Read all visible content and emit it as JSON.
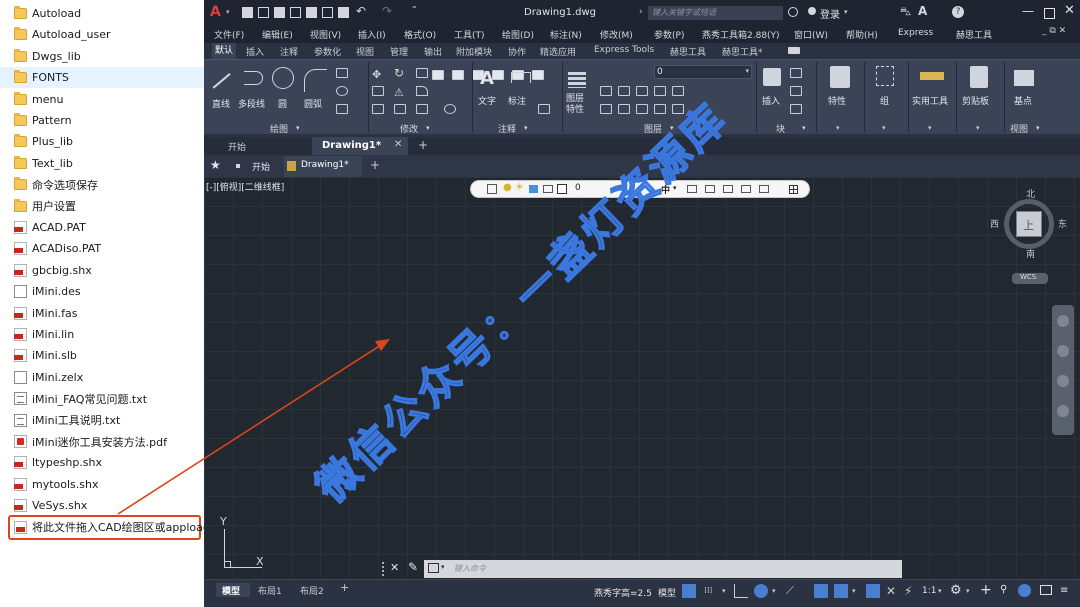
{
  "explorer": {
    "files": [
      {
        "name": "Autoload",
        "type": "folder",
        "selected": false,
        "highlight": false
      },
      {
        "name": "Autoload_user",
        "type": "folder",
        "selected": false,
        "highlight": false
      },
      {
        "name": "Dwgs_lib",
        "type": "folder",
        "selected": false,
        "highlight": false
      },
      {
        "name": "FONTS",
        "type": "folder",
        "selected": true,
        "highlight": false
      },
      {
        "name": "menu",
        "type": "folder",
        "selected": false,
        "highlight": false
      },
      {
        "name": "Pattern",
        "type": "folder",
        "selected": false,
        "highlight": false
      },
      {
        "name": "Plus_lib",
        "type": "folder",
        "selected": false,
        "highlight": false
      },
      {
        "name": "Text_lib",
        "type": "folder",
        "selected": false,
        "highlight": false
      },
      {
        "name": "命令选项保存",
        "type": "folder",
        "selected": false,
        "highlight": false
      },
      {
        "name": "用户设置",
        "type": "folder",
        "selected": false,
        "highlight": false
      },
      {
        "name": "ACAD.PAT",
        "type": "red",
        "selected": false,
        "highlight": false
      },
      {
        "name": "ACADiso.PAT",
        "type": "red",
        "selected": false,
        "highlight": false
      },
      {
        "name": "gbcbig.shx",
        "type": "red",
        "selected": false,
        "highlight": false
      },
      {
        "name": "iMini.des",
        "type": "doc",
        "selected": false,
        "highlight": false
      },
      {
        "name": "iMini.fas",
        "type": "red",
        "selected": false,
        "highlight": false
      },
      {
        "name": "iMini.lin",
        "type": "red",
        "selected": false,
        "highlight": false
      },
      {
        "name": "iMini.slb",
        "type": "red",
        "selected": false,
        "highlight": false
      },
      {
        "name": "iMini.zelx",
        "type": "doc",
        "selected": false,
        "highlight": false
      },
      {
        "name": "iMini_FAQ常见问题.txt",
        "type": "txt",
        "selected": false,
        "highlight": false
      },
      {
        "name": "iMini工具说明.txt",
        "type": "txt",
        "selected": false,
        "highlight": false
      },
      {
        "name": "iMini迷你工具安装方法.pdf",
        "type": "pdf",
        "selected": false,
        "highlight": false
      },
      {
        "name": "ltypeshp.shx",
        "type": "red",
        "selected": false,
        "highlight": false
      },
      {
        "name": "mytools.shx",
        "type": "red",
        "selected": false,
        "highlight": false
      },
      {
        "name": "VeSys.shx",
        "type": "red",
        "selected": false,
        "highlight": false
      },
      {
        "name": "将此文件拖入CAD绘图区或appload命...",
        "type": "lsp",
        "selected": false,
        "highlight": true
      }
    ]
  },
  "app": {
    "doc_title": "Drawing1.dwg",
    "search_placeholder": "键入关键字或短语",
    "login": "登录",
    "menu": [
      "文件(F)",
      "编辑(E)",
      "视图(V)",
      "插入(I)",
      "格式(O)",
      "工具(T)",
      "绘图(D)",
      "标注(N)",
      "修改(M)",
      "参数(P)",
      "燕秀工具箱2.88(Y)",
      "窗口(W)",
      "帮助(H)",
      "Express",
      "赫思工具"
    ],
    "ribbon_tabs": [
      "默认",
      "插入",
      "注释",
      "参数化",
      "视图",
      "管理",
      "输出",
      "附加模块",
      "协作",
      "精选应用",
      "Express Tools",
      "赫思工具",
      "赫思工具*"
    ],
    "ribbon_labels": {
      "line": "直线",
      "polyline": "多段线",
      "circle": "圆",
      "arc": "圆弧",
      "text": "文字",
      "dimension": "标注",
      "layer_props": "图层\n特性",
      "insert": "插入",
      "properties": "特性",
      "group": "组",
      "utilities": "实用工具",
      "clipboard": "剪贴板",
      "base": "基点"
    },
    "panels": [
      "绘图",
      "修改",
      "注释",
      "图层",
      "块",
      "视图"
    ],
    "layer_value": "0",
    "doc_tabs": [
      "开始",
      "Drawing1*"
    ],
    "file_tabs": [
      "开始",
      "Drawing1*"
    ],
    "viewport_label": "[-][俯视][二维线框]",
    "layer_toolbar_value": "0",
    "layer_toolbar_right": "中",
    "compass": {
      "north": "北",
      "south": "南",
      "east": "东",
      "west": "西",
      "top": "上",
      "wcs": "WCS"
    },
    "axis": {
      "y": "Y",
      "x": "X"
    },
    "command_placeholder": "键入命令",
    "layout_tabs": [
      "模型",
      "布局1",
      "布局2"
    ],
    "status": {
      "text_height": "燕秀字高=2.5",
      "model": "模型",
      "scale": "1:1"
    },
    "watermark": "微信公众号：一盏灯资源库"
  },
  "colors": {
    "highlight": "#d9461b",
    "accent": "#3a78e0"
  }
}
